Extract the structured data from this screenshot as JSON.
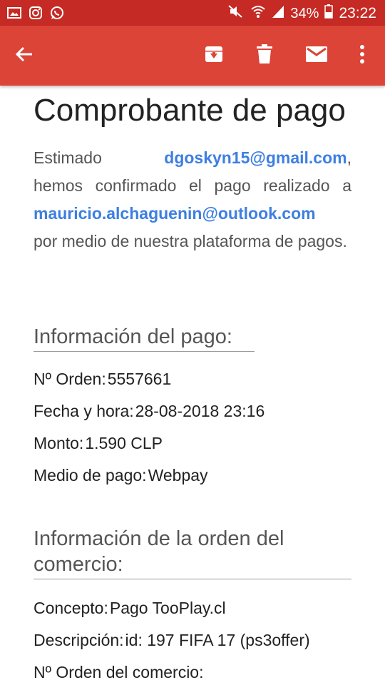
{
  "status_bar": {
    "time": "23:22",
    "battery": "34%",
    "icons": [
      "gallery-icon",
      "instagram-icon",
      "whatsapp-icon",
      "mute-icon",
      "wifi-icon",
      "signal-icon",
      "battery-icon"
    ]
  },
  "toolbar": {
    "icons": [
      "back-arrow-icon",
      "archive-icon",
      "delete-icon",
      "mark-unread-icon",
      "more-vert-icon"
    ]
  },
  "email": {
    "title": "Comprobante de pago",
    "intro_greeting": "Estimado",
    "intro_email": "dgoskyn15@gmail.com",
    "intro_comma": ",",
    "intro_mid": "hemos confirmado el pago realizado a",
    "intro_merchant_email": "mauricio.alchaguenin@outlook.com",
    "intro_end": "por medio de nuestra plataforma de pagos.",
    "payment_section_title": "Información del pago:",
    "payment_info": {
      "order_label": "Nº Orden:",
      "order_value": "5557661",
      "date_label": "Fecha y hora:",
      "date_value": "28-08-2018 23:16",
      "amount_label": "Monto:",
      "amount_value": "1.590 CLP",
      "method_label": "Medio de pago:",
      "method_value": "Webpay"
    },
    "order_section_title": "Información de la orden del comercio:",
    "order_info": {
      "concept_label": "Concepto:",
      "concept_value": "Pago TooPlay.cl",
      "description_label": "Descripción:",
      "description_value": "id: 197 FIFA 17 (ps3offer)",
      "merchant_order_label": "Nº Orden del comercio:"
    }
  },
  "colors": {
    "status_bar": "#c62a24",
    "app_bar": "#db4437",
    "link": "#3d7fe1"
  }
}
